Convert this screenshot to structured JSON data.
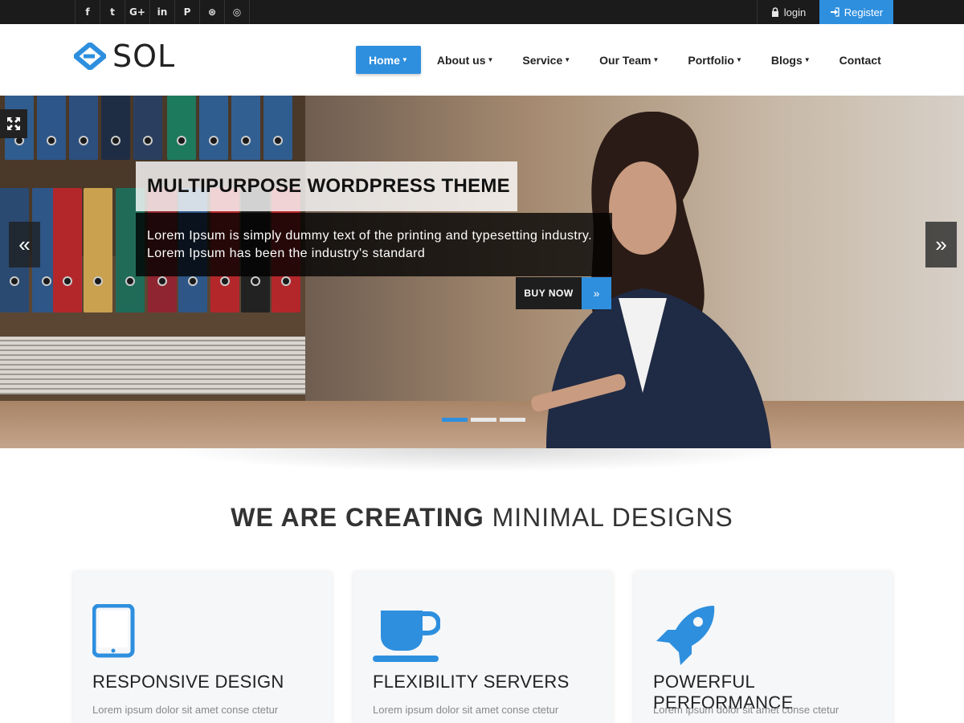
{
  "topbar": {
    "social": [
      {
        "icon": "facebook-icon",
        "glyph": "f"
      },
      {
        "icon": "twitter-icon",
        "glyph": "t"
      },
      {
        "icon": "google-plus-icon",
        "glyph": "G+"
      },
      {
        "icon": "linkedin-icon",
        "glyph": "in"
      },
      {
        "icon": "pinterest-icon",
        "glyph": "P"
      },
      {
        "icon": "dribbble-icon",
        "glyph": "⊛"
      },
      {
        "icon": "instagram-icon",
        "glyph": "◎"
      }
    ],
    "login_label": "login",
    "register_label": "Register"
  },
  "header": {
    "logo_text": "SOL",
    "nav": [
      {
        "label": "Home",
        "active": true,
        "dropdown": true
      },
      {
        "label": "About us",
        "active": false,
        "dropdown": true
      },
      {
        "label": "Service",
        "active": false,
        "dropdown": true
      },
      {
        "label": "Our Team",
        "active": false,
        "dropdown": true
      },
      {
        "label": "Portfolio",
        "active": false,
        "dropdown": true
      },
      {
        "label": "Blogs",
        "active": false,
        "dropdown": true
      },
      {
        "label": "Contact",
        "active": false,
        "dropdown": false
      }
    ]
  },
  "hero": {
    "title": "MULTIPURPOSE WORDPRESS THEME",
    "description": "Lorem Ipsum is simply dummy text of the printing and typesetting industry. Lorem Ipsum has been the industry's standard",
    "button_label": "BUY NOW",
    "prev_glyph": "«",
    "next_glyph": "»",
    "slides": 3,
    "active_slide": 0
  },
  "section": {
    "headline_bold": "WE ARE CREATING",
    "headline_light": "MINIMAL DESIGNS"
  },
  "features": [
    {
      "icon": "tablet-icon",
      "title": "RESPONSIVE DESIGN",
      "text": "Lorem ipsum dolor sit amet conse ctetur"
    },
    {
      "icon": "coffee-cup-icon",
      "title": "FLEXIBILITY SERVERS",
      "text": "Lorem ipsum dolor sit amet conse ctetur"
    },
    {
      "icon": "rocket-icon",
      "title": "POWERFUL PERFORMANCE",
      "text": "Lorem ipsum dolor sit amet conse ctetur"
    }
  ],
  "colors": {
    "accent": "#2e8fde",
    "topbar": "#1b1b1b",
    "text": "#333333"
  }
}
